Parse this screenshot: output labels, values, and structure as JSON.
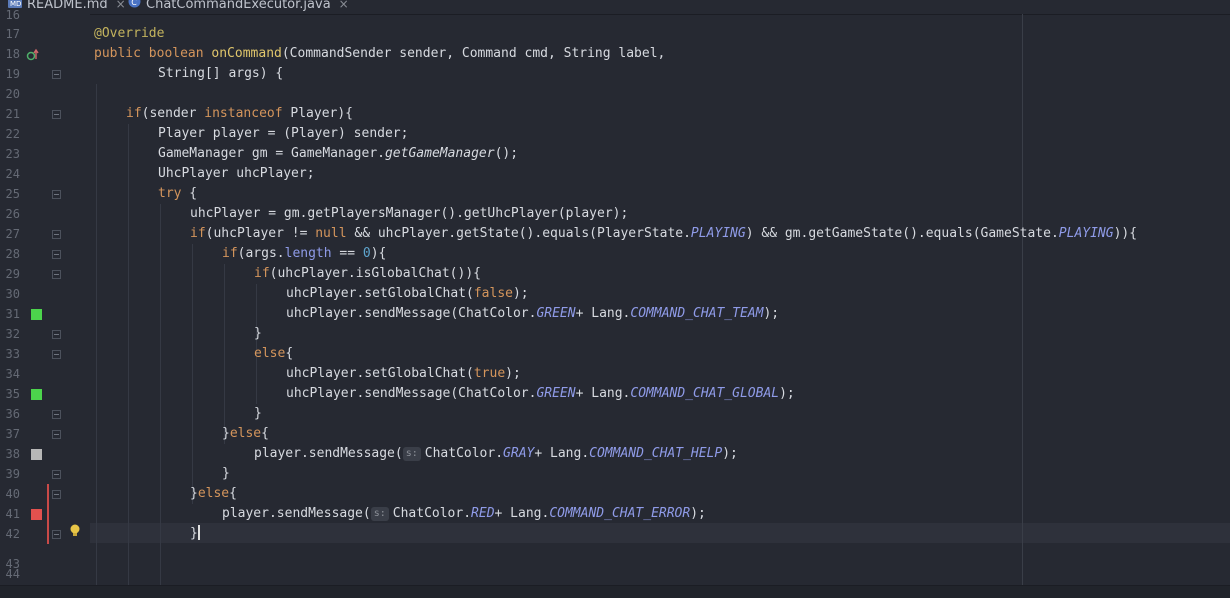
{
  "tabs": [
    {
      "label": "README.md",
      "icon": "markdown-file-icon",
      "active": false
    },
    {
      "label": "ChatCommandExecutor.java",
      "icon": "java-class-icon",
      "active": true
    }
  ],
  "gutter": {
    "line_numbers": [
      "16",
      "17",
      "18",
      "19",
      "20",
      "21",
      "22",
      "23",
      "24",
      "25",
      "26",
      "27",
      "28",
      "29",
      "30",
      "31",
      "32",
      "33",
      "34",
      "35",
      "36",
      "37",
      "38",
      "39",
      "40",
      "41",
      "42",
      "43",
      "44"
    ],
    "markers": [
      {
        "line": "31",
        "color": "#4cd44c"
      },
      {
        "line": "35",
        "color": "#4cd44c"
      },
      {
        "line": "38",
        "color": "#b7b7b7"
      },
      {
        "line": "41",
        "color": "#e2514e"
      }
    ],
    "override_icon": "override-method-icon",
    "intention_icon": "lightbulb-icon"
  },
  "code": {
    "l17": "@Override",
    "l18_a": "public boolean ",
    "l18_b": "onCommand",
    "l18_c": "(CommandSender sender, Command cmd, String label,",
    "l19": "String[] args) {",
    "l21_a": "if",
    "l21_b": "(sender ",
    "l21_c": "instanceof",
    "l21_d": " Player){",
    "l22": "Player player = (Player) sender;",
    "l23_a": "GameManager gm = GameManager.",
    "l23_b": "getGameManager",
    "l23_c": "();",
    "l24": "UhcPlayer uhcPlayer;",
    "l25_a": "try",
    "l25_b": " {",
    "l26": "uhcPlayer = gm.getPlayersManager().getUhcPlayer(player);",
    "l27_a": "if",
    "l27_b": "(uhcPlayer != ",
    "l27_c": "null",
    "l27_d": " && uhcPlayer.getState().equals(PlayerState.",
    "l27_e": "PLAYING",
    "l27_f": ") && gm.getGameState().equals(GameState.",
    "l27_g": "PLAYING",
    "l27_h": ")){",
    "l28_a": "if",
    "l28_b": "(args.",
    "l28_c": "length",
    "l28_d": " == ",
    "l28_e": "0",
    "l28_f": "){",
    "l29_a": "if",
    "l29_b": "(uhcPlayer.isGlobalChat()){",
    "l30_a": "uhcPlayer.setGlobalChat(",
    "l30_b": "false",
    "l30_c": ");",
    "l31_a": "uhcPlayer.sendMessage(ChatColor.",
    "l31_b": "GREEN",
    "l31_c": "+ Lang.",
    "l31_d": "COMMAND_CHAT_TEAM",
    "l31_e": ");",
    "l32": "}",
    "l33_a": "else",
    "l33_b": "{",
    "l34_a": "uhcPlayer.setGlobalChat(",
    "l34_b": "true",
    "l34_c": ");",
    "l35_a": "uhcPlayer.sendMessage(ChatColor.",
    "l35_b": "GREEN",
    "l35_c": "+ Lang.",
    "l35_d": "COMMAND_CHAT_GLOBAL",
    "l35_e": ");",
    "l36": "}",
    "l37_a": "}",
    "l37_b": "else",
    "l37_c": "{",
    "l38_a": "player.sendMessage(",
    "l38_hint": "s:",
    "l38_b": "ChatColor.",
    "l38_c": "GRAY",
    "l38_d": "+ Lang.",
    "l38_e": "COMMAND_CHAT_HELP",
    "l38_f": ");",
    "l39": "}",
    "l40_a": "}",
    "l40_b": "else",
    "l40_c": "{",
    "l41_a": "player.sendMessage(",
    "l41_hint": "s:",
    "l41_b": "ChatColor.",
    "l41_c": "RED",
    "l41_d": "+ Lang.",
    "l41_e": "COMMAND_CHAT_ERROR",
    "l41_f": ");",
    "l42": "}"
  },
  "colors": {
    "background": "#262932",
    "keyword": "#d4955c",
    "annotation": "#c4b45e",
    "method_decl": "#e0c66c",
    "number": "#5fa6cf",
    "constant": "#8f9be8",
    "text": "#d7dae0",
    "active_tab_underline": "#a46fd1"
  }
}
